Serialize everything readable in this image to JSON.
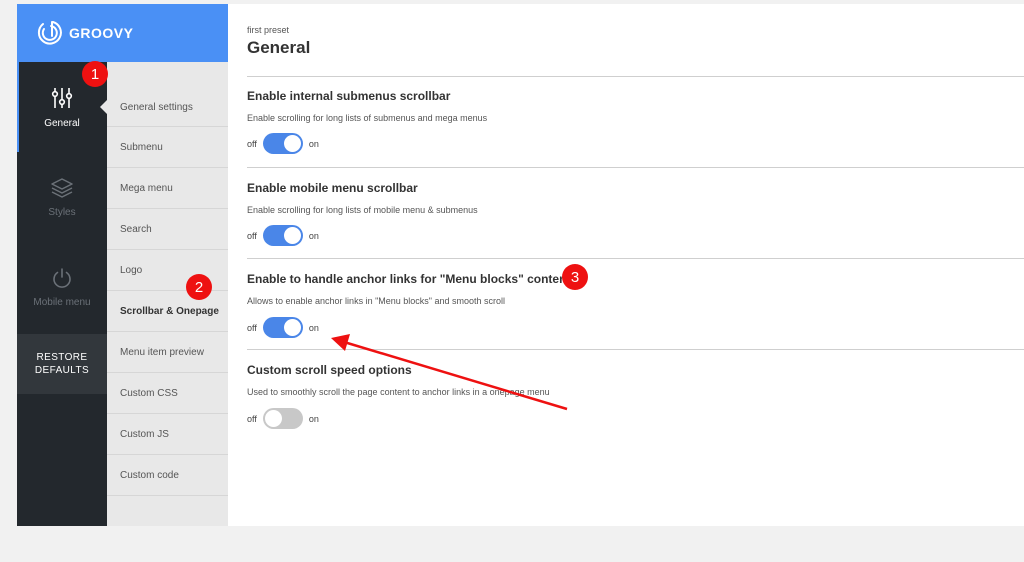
{
  "brand": {
    "name": "GROOVY"
  },
  "rail": {
    "general_label": "General",
    "styles_label": "Styles",
    "mobile_label": "Mobile menu",
    "restore_line1": "RESTORE",
    "restore_line2": "DEFAULTS"
  },
  "submenu": {
    "items": [
      {
        "label": "General settings"
      },
      {
        "label": "Submenu"
      },
      {
        "label": "Mega menu"
      },
      {
        "label": "Search"
      },
      {
        "label": "Logo"
      },
      {
        "label": "Scrollbar & Onepage"
      },
      {
        "label": "Menu item preview"
      },
      {
        "label": "Custom CSS"
      },
      {
        "label": "Custom JS"
      },
      {
        "label": "Custom code"
      }
    ],
    "active": "Scrollbar & Onepage"
  },
  "main": {
    "preset": "first preset",
    "title": "General",
    "off_label": "off",
    "on_label": "on",
    "sections": [
      {
        "title": "Enable internal submenus scrollbar",
        "desc": "Enable scrolling for long lists of submenus and mega menus",
        "enabled": true
      },
      {
        "title": "Enable mobile menu scrollbar",
        "desc": "Enable scrolling for long lists of mobile menu & submenus",
        "enabled": true
      },
      {
        "title": "Enable to handle anchor links for \"Menu blocks\" content",
        "desc": "Allows to enable anchor links in \"Menu blocks\" and smooth scroll",
        "enabled": true
      },
      {
        "title": "Custom scroll speed options",
        "desc": "Used to smoothly scroll the page content to anchor links in a onepage menu",
        "enabled": false
      }
    ]
  },
  "annotations": {
    "badge1": "1",
    "badge2": "2",
    "badge3": "3"
  },
  "colors": {
    "accent": "#4a90f5",
    "rail": "#23282d",
    "badge": "#ee1111"
  }
}
